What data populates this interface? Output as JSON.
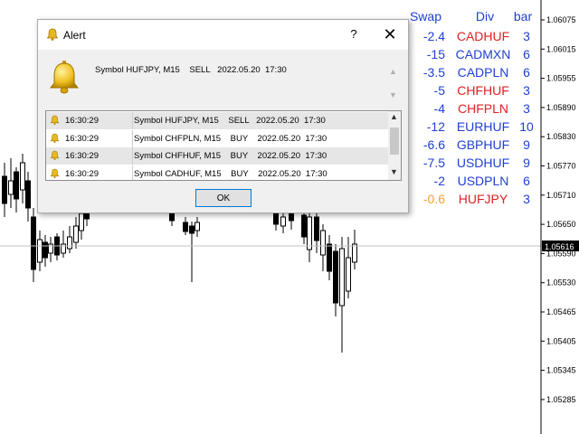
{
  "chart": {
    "axis_labels": [
      "1.06075",
      "1.06015",
      "1.05955",
      "1.05890",
      "1.05830",
      "1.05770",
      "1.05710",
      "1.05650",
      "1.05590",
      "1.05530",
      "1.05465",
      "1.05405",
      "1.05345",
      "1.05285"
    ],
    "current_price": "1.05616",
    "bid_line_color": "#c0c0c0",
    "bid_tag_color": "#000000"
  },
  "table": {
    "headers": {
      "swap": "Swap",
      "div": "Div",
      "bar": "bar"
    },
    "rows": [
      {
        "swap": "-2.4",
        "pair": "CADHUF",
        "bar": "3",
        "swap_color": "#1f3fd4",
        "pair_color": "#e02020"
      },
      {
        "swap": "-15",
        "pair": "CADMXN",
        "bar": "6",
        "swap_color": "#1f3fd4",
        "pair_color": "#1f3fd4"
      },
      {
        "swap": "-3.5",
        "pair": "CADPLN",
        "bar": "6",
        "swap_color": "#1f3fd4",
        "pair_color": "#1f3fd4"
      },
      {
        "swap": "-5",
        "pair": "CHFHUF",
        "bar": "3",
        "swap_color": "#1f3fd4",
        "pair_color": "#e02020"
      },
      {
        "swap": "-4",
        "pair": "CHFPLN",
        "bar": "3",
        "swap_color": "#1f3fd4",
        "pair_color": "#e02020"
      },
      {
        "swap": "-12",
        "pair": "EURHUF",
        "bar": "10",
        "swap_color": "#1f3fd4",
        "pair_color": "#1f3fd4"
      },
      {
        "swap": "-6.6",
        "pair": "GBPHUF",
        "bar": "9",
        "swap_color": "#1f3fd4",
        "pair_color": "#1f3fd4"
      },
      {
        "swap": "-7.5",
        "pair": "USDHUF",
        "bar": "9",
        "swap_color": "#1f3fd4",
        "pair_color": "#1f3fd4"
      },
      {
        "swap": "-2",
        "pair": "USDPLN",
        "bar": "6",
        "swap_color": "#1f3fd4",
        "pair_color": "#1f3fd4"
      },
      {
        "swap": "-0.6",
        "pair": "HUFJPY",
        "bar": "3",
        "swap_color": "#f5a030",
        "pair_color": "#e02020"
      }
    ]
  },
  "dialog": {
    "title": "Alert",
    "help": "?",
    "close": "✕",
    "message": "Symbol HUFJPY, M15    SELL   2022.05.20  17:30",
    "list": [
      {
        "time": "16:30:29",
        "text": "Symbol HUFJPY, M15    SELL   2022.05.20  17:30"
      },
      {
        "time": "16:30:29",
        "text": "Symbol CHFPLN, M15    BUY    2022.05.20  17:30"
      },
      {
        "time": "16:30:29",
        "text": "Symbol CHFHUF, M15    BUY    2022.05.20  17:30"
      },
      {
        "time": "16:30:29",
        "text": "Symbol CADHUF, M15    BUY    2022.05.20  17:30"
      }
    ],
    "ok_label": "OK"
  },
  "icons": {
    "title": "bell-icon",
    "message": "bell-icon"
  }
}
